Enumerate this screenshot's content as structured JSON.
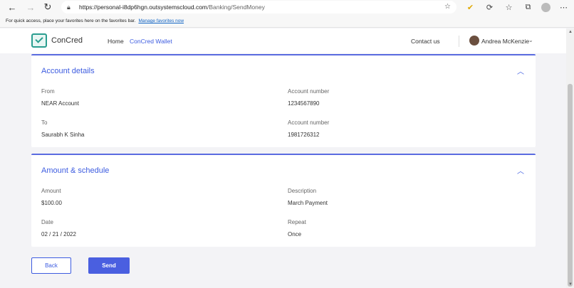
{
  "browser": {
    "url_host": "https://personal-i8dp6hgn.outsystemscloud.com",
    "url_path": "/Banking/SendMoney",
    "favorites_text": "For quick access, place your favorites here on the favorites bar.",
    "favorites_link": "Manage favorites now"
  },
  "header": {
    "brand": "ConCred",
    "nav_home": "Home",
    "nav_wallet": "ConCred Wallet",
    "contact": "Contact us",
    "user_name": "Andrea McKenzie"
  },
  "account_details": {
    "title": "Account details",
    "from_label": "From",
    "from_value": "NEAR Account",
    "from_account_label": "Account number",
    "from_account_value": "1234567890",
    "to_label": "To",
    "to_value": "Saurabh K Sinha",
    "to_account_label": "Account number",
    "to_account_value": "1981726312"
  },
  "amount_schedule": {
    "title": "Amount & schedule",
    "amount_label": "Amount",
    "amount_value": "$100.00",
    "description_label": "Description",
    "description_value": "March Payment",
    "date_label": "Date",
    "date_value": "02 / 21 / 2022",
    "repeat_label": "Repeat",
    "repeat_value": "Once"
  },
  "actions": {
    "back_label": "Back",
    "send_label": "Send"
  },
  "colors": {
    "accent": "#3d5ce0",
    "send_button": "#4a5fe0",
    "brand": "#2a9d8f"
  }
}
